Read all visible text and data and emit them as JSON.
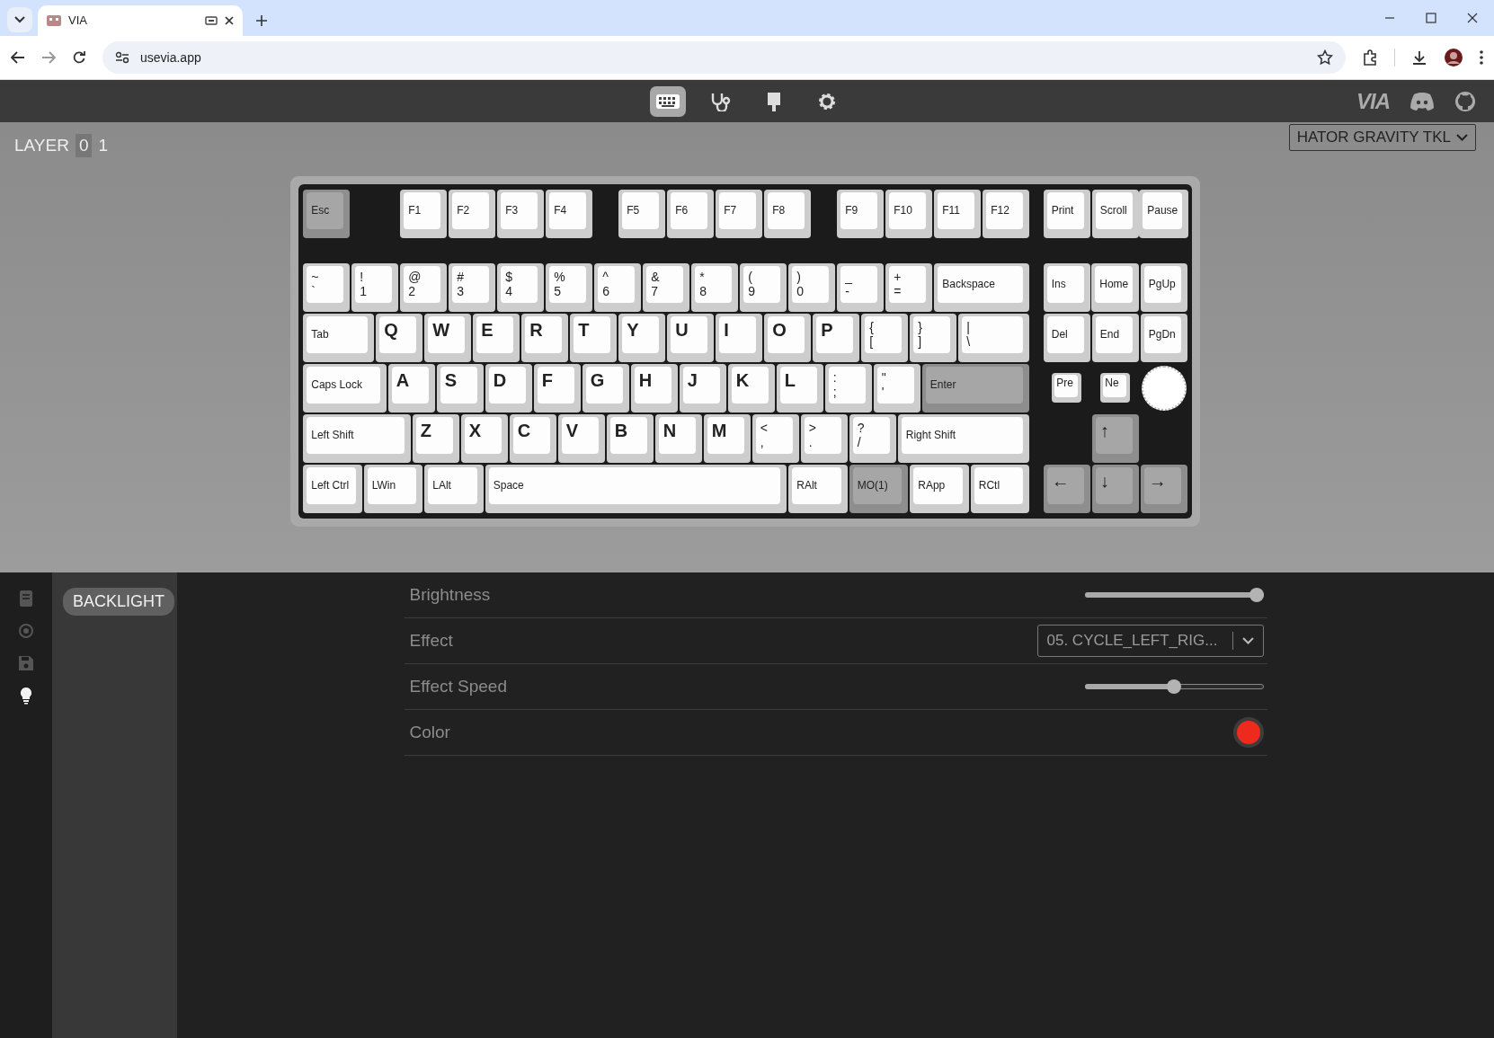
{
  "browser": {
    "tab_title": "VIA",
    "url": "usevia.app"
  },
  "header": {
    "nav": [
      {
        "selected": true
      },
      {
        "selected": false
      },
      {
        "selected": false
      },
      {
        "selected": false
      }
    ],
    "logo": "VIA"
  },
  "layer": {
    "label": "LAYER",
    "layers": [
      {
        "label": "0",
        "selected": true
      },
      {
        "label": "1",
        "selected": false
      }
    ]
  },
  "keyboard_select": {
    "value": "HATOR GRAVITY TKL"
  },
  "keyboard": {
    "keys": [
      {
        "legends": [
          "Esc"
        ],
        "accent": true
      },
      {
        "legends": [
          "F1"
        ],
        "accent": false
      },
      {
        "legends": [
          "F2"
        ],
        "accent": false
      },
      {
        "legends": [
          "F3"
        ],
        "accent": false
      },
      {
        "legends": [
          "F4"
        ],
        "accent": false
      },
      {
        "legends": [
          "F5"
        ],
        "accent": false
      },
      {
        "legends": [
          "F6"
        ],
        "accent": false
      },
      {
        "legends": [
          "F7"
        ],
        "accent": false
      },
      {
        "legends": [
          "F8"
        ],
        "accent": false
      },
      {
        "legends": [
          "F9"
        ],
        "accent": false
      },
      {
        "legends": [
          "F10"
        ],
        "accent": false
      },
      {
        "legends": [
          "F11"
        ],
        "accent": false
      },
      {
        "legends": [
          "F12"
        ],
        "accent": false
      },
      {
        "legends": [
          "Print"
        ],
        "accent": false
      },
      {
        "legends": [
          "Scroll"
        ],
        "accent": false
      },
      {
        "legends": [
          "Pause"
        ],
        "accent": false
      },
      {
        "legends": [
          "~",
          "`"
        ],
        "accent": false
      },
      {
        "legends": [
          "!",
          "1"
        ],
        "accent": false
      },
      {
        "legends": [
          "@",
          "2"
        ],
        "accent": false
      },
      {
        "legends": [
          "#",
          "3"
        ],
        "accent": false
      },
      {
        "legends": [
          "$",
          "4"
        ],
        "accent": false
      },
      {
        "legends": [
          "%",
          "5"
        ],
        "accent": false
      },
      {
        "legends": [
          "^",
          "6"
        ],
        "accent": false
      },
      {
        "legends": [
          "&",
          "7"
        ],
        "accent": false
      },
      {
        "legends": [
          "*",
          "8"
        ],
        "accent": false
      },
      {
        "legends": [
          "(",
          "9"
        ],
        "accent": false
      },
      {
        "legends": [
          ")",
          "0"
        ],
        "accent": false
      },
      {
        "legends": [
          "_",
          "-"
        ],
        "accent": false
      },
      {
        "legends": [
          "+",
          "="
        ],
        "accent": false
      },
      {
        "legends": [
          "Backspace"
        ],
        "accent": false
      },
      {
        "legends": [
          "Ins"
        ],
        "accent": false
      },
      {
        "legends": [
          "Home"
        ],
        "accent": false
      },
      {
        "legends": [
          "PgUp"
        ],
        "accent": false
      },
      {
        "legends": [
          "Tab"
        ],
        "accent": false
      },
      {
        "legends": [
          "Q"
        ],
        "accent": false
      },
      {
        "legends": [
          "W"
        ],
        "accent": false
      },
      {
        "legends": [
          "E"
        ],
        "accent": false
      },
      {
        "legends": [
          "R"
        ],
        "accent": false
      },
      {
        "legends": [
          "T"
        ],
        "accent": false
      },
      {
        "legends": [
          "Y"
        ],
        "accent": false
      },
      {
        "legends": [
          "U"
        ],
        "accent": false
      },
      {
        "legends": [
          "I"
        ],
        "accent": false
      },
      {
        "legends": [
          "O"
        ],
        "accent": false
      },
      {
        "legends": [
          "P"
        ],
        "accent": false
      },
      {
        "legends": [
          "{",
          "["
        ],
        "accent": false
      },
      {
        "legends": [
          "}",
          "]"
        ],
        "accent": false
      },
      {
        "legends": [
          "|",
          "\\"
        ],
        "accent": false
      },
      {
        "legends": [
          "Del"
        ],
        "accent": false
      },
      {
        "legends": [
          "End"
        ],
        "accent": false
      },
      {
        "legends": [
          "PgDn"
        ],
        "accent": false
      },
      {
        "legends": [
          "Caps Lock"
        ],
        "accent": false
      },
      {
        "legends": [
          "A"
        ],
        "accent": false
      },
      {
        "legends": [
          "S"
        ],
        "accent": false
      },
      {
        "legends": [
          "D"
        ],
        "accent": false
      },
      {
        "legends": [
          "F"
        ],
        "accent": false
      },
      {
        "legends": [
          "G"
        ],
        "accent": false
      },
      {
        "legends": [
          "H"
        ],
        "accent": false
      },
      {
        "legends": [
          "J"
        ],
        "accent": false
      },
      {
        "legends": [
          "K"
        ],
        "accent": false
      },
      {
        "legends": [
          "L"
        ],
        "accent": false
      },
      {
        "legends": [
          ":",
          ";"
        ],
        "accent": false
      },
      {
        "legends": [
          "\"",
          "'"
        ],
        "accent": false
      },
      {
        "legends": [
          "Enter"
        ],
        "accent": true
      },
      {
        "legends": [
          "Pre"
        ],
        "accent": false
      },
      {
        "legends": [
          "Ne"
        ],
        "accent": false
      },
      {
        "legends": [
          "Left Shift"
        ],
        "accent": false
      },
      {
        "legends": [
          "Z"
        ],
        "accent": false
      },
      {
        "legends": [
          "X"
        ],
        "accent": false
      },
      {
        "legends": [
          "C"
        ],
        "accent": false
      },
      {
        "legends": [
          "V"
        ],
        "accent": false
      },
      {
        "legends": [
          "B"
        ],
        "accent": false
      },
      {
        "legends": [
          "N"
        ],
        "accent": false
      },
      {
        "legends": [
          "M"
        ],
        "accent": false
      },
      {
        "legends": [
          "<",
          ","
        ],
        "accent": false
      },
      {
        "legends": [
          ">",
          "."
        ],
        "accent": false
      },
      {
        "legends": [
          "?",
          "/"
        ],
        "accent": false
      },
      {
        "legends": [
          "Right Shift"
        ],
        "accent": false
      },
      {
        "legends": [
          "↑"
        ],
        "accent": true
      },
      {
        "legends": [
          "Left Ctrl"
        ],
        "accent": false
      },
      {
        "legends": [
          "LWin"
        ],
        "accent": false
      },
      {
        "legends": [
          "LAlt"
        ],
        "accent": false
      },
      {
        "legends": [
          "Space"
        ],
        "accent": false
      },
      {
        "legends": [
          "RAlt"
        ],
        "accent": false
      },
      {
        "legends": [
          "MO(1)"
        ],
        "accent": true
      },
      {
        "legends": [
          "RApp"
        ],
        "accent": false
      },
      {
        "legends": [
          "RCtl"
        ],
        "accent": false
      },
      {
        "legends": [
          "←"
        ],
        "accent": true
      },
      {
        "legends": [
          "↓"
        ],
        "accent": true
      },
      {
        "legends": [
          "→"
        ],
        "accent": true
      }
    ]
  },
  "sidebar": [
    {
      "selected": false
    },
    {
      "selected": false
    },
    {
      "selected": false
    },
    {
      "selected": true
    }
  ],
  "menu": [
    {
      "label": "BACKLIGHT",
      "selected": true
    }
  ],
  "settings": [
    {
      "kind": "slider",
      "label": "Brightness",
      "level": 1.0
    },
    {
      "kind": "select",
      "label": "Effect",
      "value": "05. CYCLE_LEFT_RIG..."
    },
    {
      "kind": "slider",
      "label": "Effect Speed",
      "level": 0.5
    },
    {
      "kind": "color",
      "label": "Color",
      "color": "#ee2a1e"
    }
  ]
}
